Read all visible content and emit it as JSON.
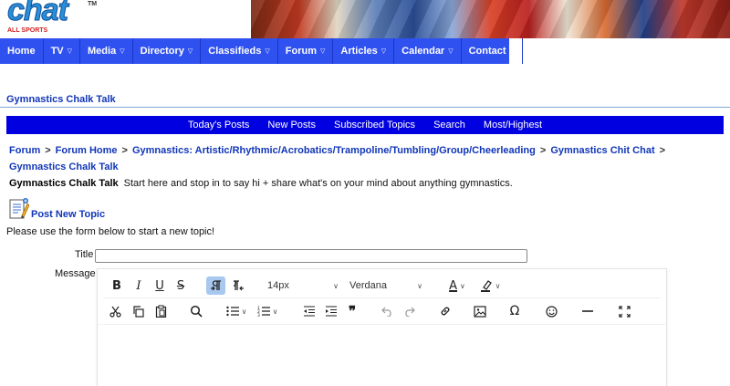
{
  "brand": {
    "logo_text": "chat",
    "tm": "TM",
    "tagline": "ALL SPORTS"
  },
  "nav": {
    "items": [
      {
        "label": "Home",
        "has_dropdown": false
      },
      {
        "label": "TV",
        "has_dropdown": true
      },
      {
        "label": "Media",
        "has_dropdown": true
      },
      {
        "label": "Directory",
        "has_dropdown": true
      },
      {
        "label": "Classifieds",
        "has_dropdown": true
      },
      {
        "label": "Forum",
        "has_dropdown": true
      },
      {
        "label": "Articles",
        "has_dropdown": true
      },
      {
        "label": "Calendar",
        "has_dropdown": true
      },
      {
        "label": "Contact",
        "has_dropdown": true
      }
    ]
  },
  "section": {
    "title": "Gymnastics Chalk Talk"
  },
  "subnav": {
    "items": [
      "Today's Posts",
      "New Posts",
      "Subscribed Topics",
      "Search",
      "Most/Highest"
    ]
  },
  "breadcrumb": {
    "items": [
      "Forum",
      "Forum Home",
      "Gymnastics: Artistic/Rhythmic/Acrobatics/Trampoline/Tumbling/Group/Cheerleading",
      "Gymnastics Chit Chat",
      "Gymnastics Chalk Talk"
    ],
    "separator": ">"
  },
  "forum": {
    "name": "Gymnastics Chalk Talk",
    "description": "Start here and stop in to say hi + share what's on your mind about anything gymnastics."
  },
  "post_new": {
    "label": "Post New Topic"
  },
  "form": {
    "instructions": "Please use the form below to start a new topic!",
    "title_label": "Title",
    "title_value": "",
    "message_label": "Message"
  },
  "editor": {
    "font_size": "14px",
    "font_family": "Verdana",
    "text_color_glyph": "A",
    "row1_buttons": [
      "bold-icon",
      "italic-icon",
      "underline-icon",
      "strikethrough-icon",
      "ltr-icon",
      "rtl-icon",
      "text-color-icon",
      "highlight-icon"
    ],
    "row2_buttons": [
      "cut-icon",
      "copy-icon",
      "paste-icon",
      "search-icon",
      "bullet-list-icon",
      "numbered-list-icon",
      "outdent-icon",
      "indent-icon",
      "blockquote-icon",
      "undo-icon",
      "redo-icon",
      "link-icon",
      "image-icon",
      "special-char-icon",
      "emoji-icon",
      "horizontal-rule-icon",
      "fullscreen-icon"
    ]
  },
  "colors": {
    "nav_bg": "#2f51f0",
    "subnav_bg": "#0000e0",
    "link": "#1136b8",
    "rule": "#7fa8d6"
  }
}
